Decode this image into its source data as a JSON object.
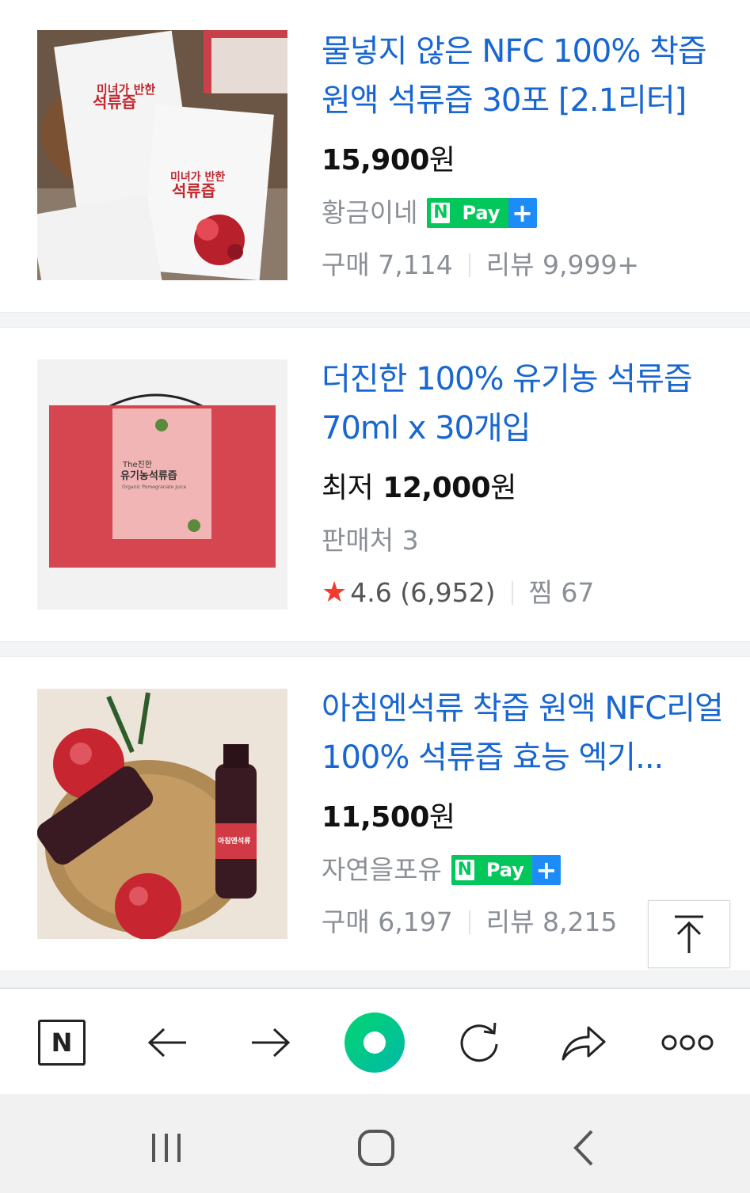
{
  "products": [
    {
      "title": "물넣지 않은 NFC 100% 착즙 원액 석류즙 30포 [2.1리터]",
      "price_prefix": "",
      "price": "15,900",
      "currency": "원",
      "seller": "황금이네",
      "npay": true,
      "purchase_label": "구매",
      "purchase_count": "7,114",
      "review_label": "리뷰",
      "review_count": "9,999+",
      "image_text": [
        "미녀가 반한",
        "석류즙"
      ]
    },
    {
      "title": "더진한 100% 유기농 석류즙 70ml x 30개입",
      "price_prefix": "최저",
      "price": "12,000",
      "currency": "원",
      "seller_count_label": "판매처 3",
      "rating": "4.6",
      "rating_count": "(6,952)",
      "zzim_label": "찜",
      "zzim_count": "67",
      "image_text": [
        "The진한",
        "유기농석류즙",
        "Organic Pomegranate Juice"
      ]
    },
    {
      "title": "아침엔석류 착즙 원액 NFC리얼 100% 석류즙 효능 엑기...",
      "price_prefix": "",
      "price": "11,500",
      "currency": "원",
      "seller": "자연을포유",
      "npay": true,
      "purchase_label": "구매",
      "purchase_count": "6,197",
      "review_label": "리뷰",
      "review_count": "8,215",
      "image_text": [
        "아침엔석류"
      ]
    }
  ],
  "npay_badge": {
    "n": "N",
    "pay": "Pay",
    "plus": "+"
  },
  "toolbar": {
    "items": [
      "naver-home",
      "back",
      "forward",
      "green-dot",
      "refresh",
      "share",
      "more"
    ],
    "naver_letter": "N",
    "more_glyph": "ooo"
  },
  "colors": {
    "title_blue": "#1766d2",
    "naver_green": "#03c75a",
    "plus_blue": "#1d8cf8",
    "star_red": "#f23a2f"
  }
}
